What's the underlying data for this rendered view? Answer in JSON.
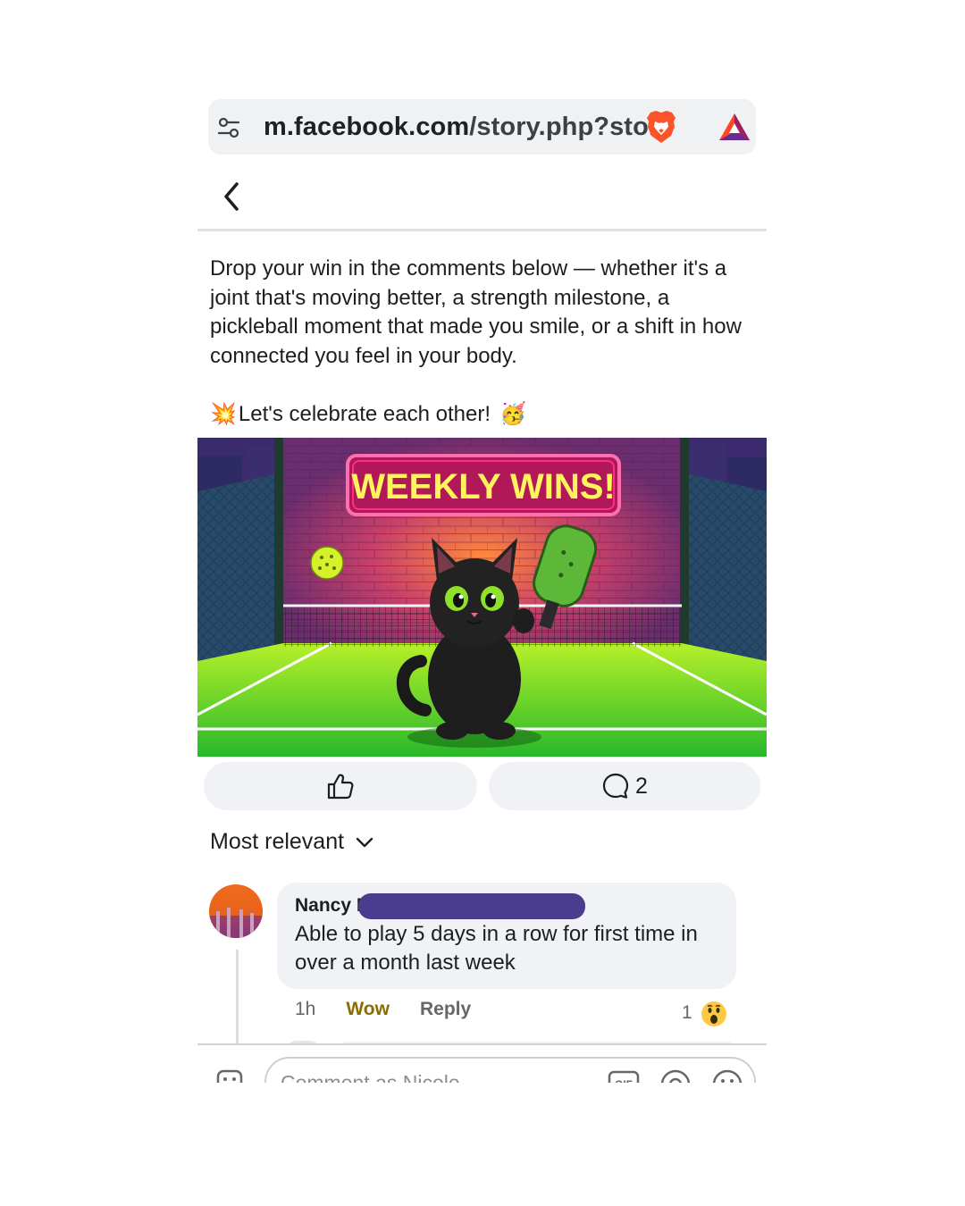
{
  "browser": {
    "url_domain": "m.facebook.com",
    "url_path": "/story.php?story",
    "icons": [
      "tune-icon",
      "brave-lion-icon",
      "bat-rewards-icon"
    ]
  },
  "nav": {
    "back_icon": "chevron-left-icon"
  },
  "post": {
    "body": "Drop your win in the comments below — whether it's a joint that's moving better, a strength milestone, a pickleball moment that made you smile, or a shift in how connected you feel in your body.",
    "celebrate_text": "Let's celebrate each other!",
    "celebrate_leading_emoji": "💥",
    "celebrate_trailing_emoji": "🥳",
    "image": {
      "sign_text": "WEEKLY  WINS!",
      "colors": {
        "sign_border": "#ff3c8a",
        "sign_text": "#fff45c",
        "court": "#4fd62b",
        "wall": "#7a2f6e"
      }
    }
  },
  "actions": {
    "like_icon": "thumbs-up-icon",
    "comment_icon": "comment-bubble-icon",
    "comment_count": "2"
  },
  "sort": {
    "label": "Most relevant",
    "icon": "chevron-down-icon"
  },
  "comment": {
    "author": "Nancy F",
    "text": "Able to play 5 days in a row for first time in over a month last week",
    "time": "1h",
    "reaction_label": "Wow",
    "reply_label": "Reply",
    "reaction_count": "1",
    "reaction_emoji": "wow-emoji",
    "redaction_color": "#4a3d8f"
  },
  "composer": {
    "placeholder": "Comment as Nicole",
    "icons": [
      "sticker-icon",
      "gif-icon",
      "at-mention-icon",
      "emoji-icon"
    ]
  }
}
